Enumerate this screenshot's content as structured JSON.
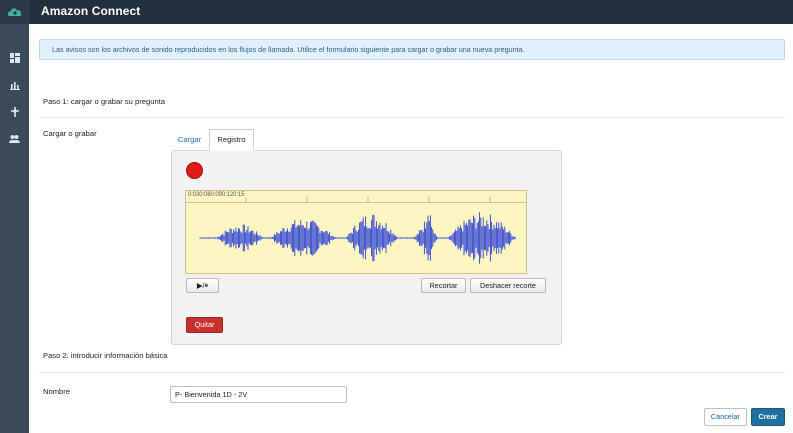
{
  "header": {
    "app_title": "Amazon Connect",
    "logo_icon": "amazon-connect-cloud-icon"
  },
  "sidebar": {
    "items": [
      {
        "icon": "dashboard-icon"
      },
      {
        "icon": "metrics-chart-icon"
      },
      {
        "icon": "routing-icon"
      },
      {
        "icon": "users-icon"
      }
    ]
  },
  "banner": {
    "text": "Las avisos son los archivos de sonido reproducidos en los flujos de llamada. Utilice el formulario siguiente para cargar o grabar una nueva pregunta."
  },
  "step1": {
    "title": "Paso 1: cargar o grabar su pregunta",
    "field_label": "Cargar o grabar",
    "tabs": [
      {
        "label": "Cargar",
        "active": false
      },
      {
        "label": "Registro",
        "active": true
      }
    ],
    "recorder": {
      "timeline_ticks": "0:030:060:090:120:15",
      "play_label": "▶/⏸",
      "trim_label": "Recortar",
      "undo_trim_label": "Deshacer recorte",
      "remove_label": "Quitar"
    }
  },
  "step2": {
    "title": "Paso 2: introducir información básica",
    "name_label": "Nombre",
    "name_value": "P- Bienvenida 1D - 2V"
  },
  "footer": {
    "cancel_label": "Cancelar",
    "create_label": "Crear"
  },
  "colors": {
    "topbar": "#232f3e",
    "sidebar": "#3b4a5a",
    "banner_bg": "#e1f0fa",
    "waveform_bg": "#fbf6c1",
    "waveform": "#2a3fd6",
    "record": "#e01a1a",
    "primary": "#1f6f9f"
  }
}
